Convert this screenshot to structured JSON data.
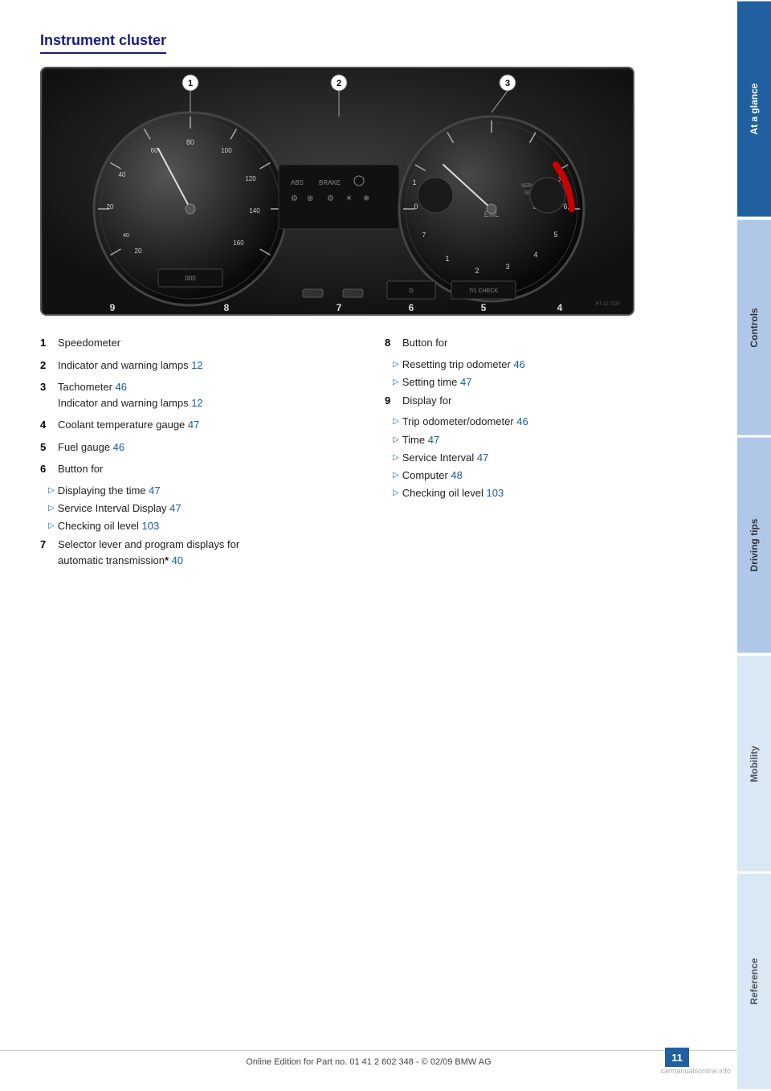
{
  "sidebar": {
    "tabs": [
      {
        "label": "At a glance",
        "state": "active"
      },
      {
        "label": "Controls",
        "state": "light"
      },
      {
        "label": "Driving tips",
        "state": "light"
      },
      {
        "label": "Mobility",
        "state": "lighter"
      },
      {
        "label": "Reference",
        "state": "lighter"
      }
    ]
  },
  "section": {
    "title": "Instrument cluster"
  },
  "items": [
    {
      "num": "1",
      "text": "Speedometer",
      "subitems": []
    },
    {
      "num": "2",
      "text": "Indicator and warning lamps",
      "ref": "12",
      "subitems": []
    },
    {
      "num": "3",
      "text": "Tachometer",
      "ref": "46",
      "subitems": [
        {
          "text": "Indicator and warning lamps",
          "ref": "12"
        }
      ]
    },
    {
      "num": "4",
      "text": "Coolant temperature gauge",
      "ref": "47",
      "subitems": []
    },
    {
      "num": "5",
      "text": "Fuel gauge",
      "ref": "46",
      "subitems": []
    },
    {
      "num": "6",
      "text": "Button for",
      "subitems": [
        {
          "text": "Displaying the time",
          "ref": "47"
        },
        {
          "text": "Service Interval Display",
          "ref": "47"
        },
        {
          "text": "Checking oil level",
          "ref": "103"
        }
      ]
    },
    {
      "num": "7",
      "text": "Selector lever and program displays for automatic transmission",
      "asterisk": "*",
      "ref": "40",
      "subitems": []
    }
  ],
  "items_right": [
    {
      "num": "8",
      "text": "Button for",
      "subitems": [
        {
          "text": "Resetting trip odometer",
          "ref": "46"
        },
        {
          "text": "Setting time",
          "ref": "47"
        }
      ]
    },
    {
      "num": "9",
      "text": "Display for",
      "subitems": [
        {
          "text": "Trip odometer/odometer",
          "ref": "46"
        },
        {
          "text": "Time",
          "ref": "47"
        },
        {
          "text": "Service Interval",
          "ref": "47"
        },
        {
          "text": "Computer",
          "ref": "48"
        },
        {
          "text": "Checking oil level",
          "ref": "103"
        }
      ]
    }
  ],
  "callout_numbers_top": [
    "1",
    "2",
    "3"
  ],
  "callout_numbers_bottom": [
    "9",
    "8",
    "7",
    "6",
    "5",
    "4"
  ],
  "footer": {
    "text": "Online Edition for Part no. 01 41 2 602 348 - © 02/09 BMW AG",
    "page": "11"
  }
}
